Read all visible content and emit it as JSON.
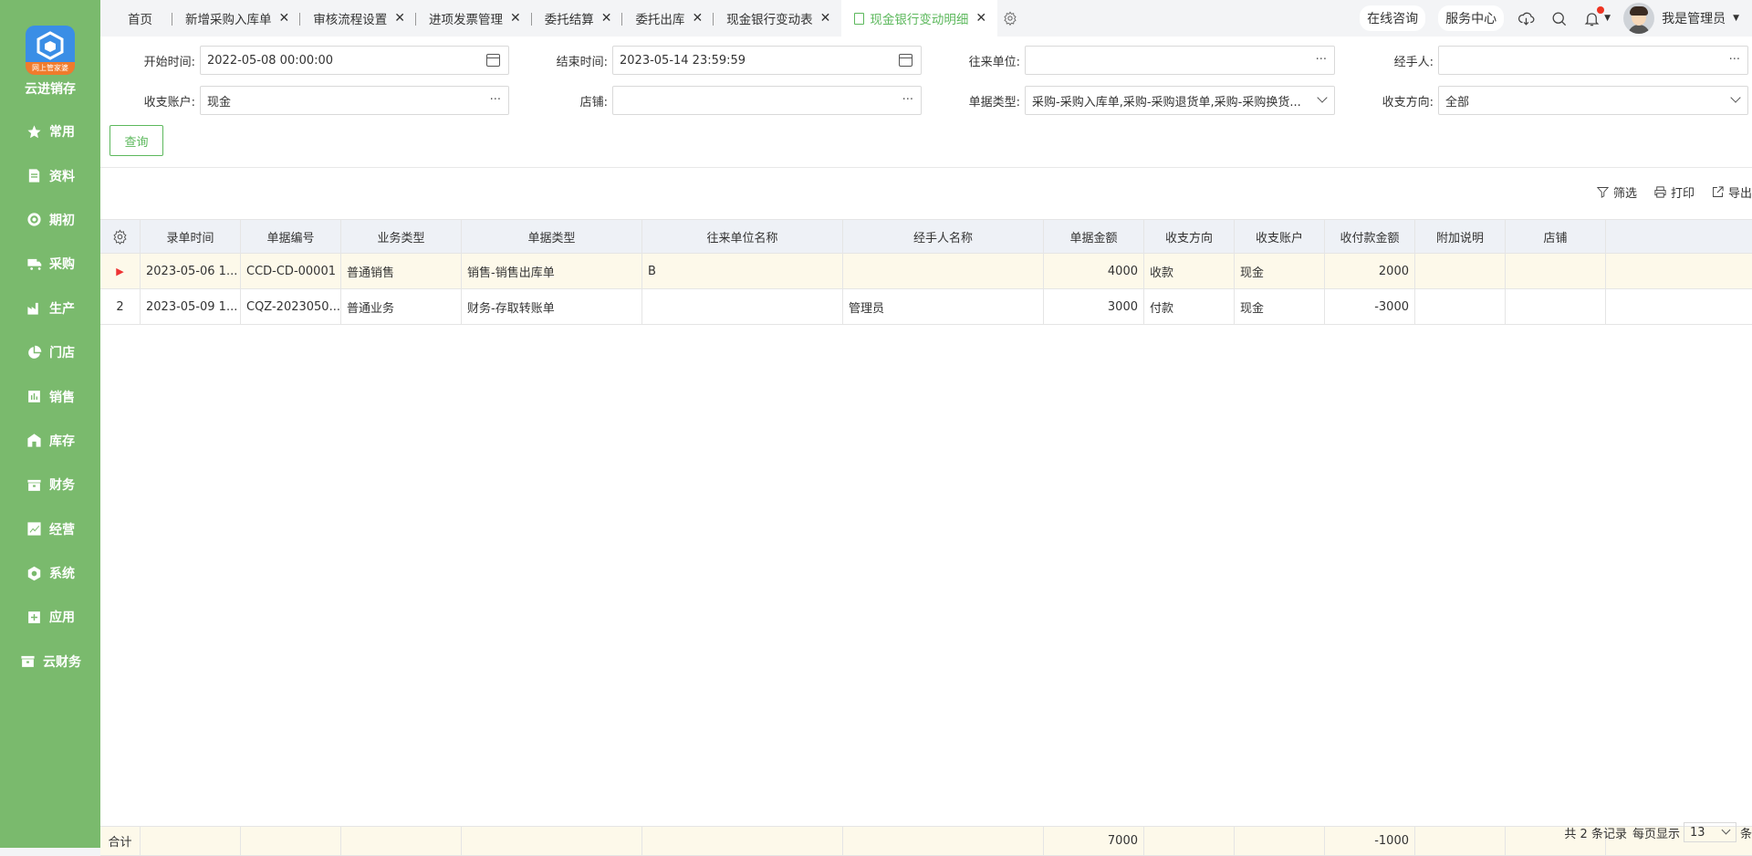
{
  "app": {
    "brand": "云进销存",
    "logo_ribbon": "网上管家婆"
  },
  "sidebar": {
    "items": [
      {
        "label": "常用",
        "icon": "star-icon"
      },
      {
        "label": "资料",
        "icon": "document-icon"
      },
      {
        "label": "期初",
        "icon": "target-icon"
      },
      {
        "label": "采购",
        "icon": "truck-icon"
      },
      {
        "label": "生产",
        "icon": "factory-icon"
      },
      {
        "label": "门店",
        "icon": "pie-chart-icon"
      },
      {
        "label": "销售",
        "icon": "bar-chart-icon"
      },
      {
        "label": "库存",
        "icon": "warehouse-icon"
      },
      {
        "label": "财务",
        "icon": "wallet-icon"
      },
      {
        "label": "经营",
        "icon": "trend-icon"
      },
      {
        "label": "系统",
        "icon": "settings-icon"
      },
      {
        "label": "应用",
        "icon": "plus-icon"
      },
      {
        "label": "云财务",
        "icon": "cloud-finance-icon"
      }
    ]
  },
  "tabs": {
    "items": [
      {
        "label": "首页"
      },
      {
        "label": "新增采购入库单"
      },
      {
        "label": "审核流程设置"
      },
      {
        "label": "进项发票管理"
      },
      {
        "label": "委托结算"
      },
      {
        "label": "委托出库"
      },
      {
        "label": "现金银行变动表"
      },
      {
        "label": "现金银行变动明细"
      }
    ]
  },
  "header": {
    "online_consult": "在线咨询",
    "service_center": "服务中心",
    "user_name": "我是管理员"
  },
  "filters": {
    "start_time_label": "开始时间:",
    "start_time_value": "2022-05-08 00:00:00",
    "end_time_label": "结束时间:",
    "end_time_value": "2023-05-14 23:59:59",
    "partner_label": "往来单位:",
    "partner_value": "",
    "handler_label": "经手人:",
    "handler_value": "",
    "account_label": "收支账户:",
    "account_value": "现金",
    "store_label": "店铺:",
    "store_value": "",
    "doc_type_label": "单据类型:",
    "doc_type_value": "采购-采购入库单,采购-采购退货单,采购-采购换货...",
    "direction_label": "收支方向:",
    "direction_value": "全部",
    "query_button": "查询"
  },
  "toolbar": {
    "filter": "筛选",
    "print": "打印",
    "export": "导出"
  },
  "table": {
    "columns": [
      "录单时间",
      "单据编号",
      "业务类型",
      "单据类型",
      "往来单位名称",
      "经手人名称",
      "单据金额",
      "收支方向",
      "收支账户",
      "收付款金额",
      "附加说明",
      "店铺"
    ],
    "rows": [
      {
        "idx": "▶",
        "time": "2023-05-06 1...",
        "code": "CCD-CD-00001",
        "biz": "普通销售",
        "doctype": "销售-销售出库单",
        "partner": "B",
        "handler": "",
        "amount": "4000",
        "dir": "收款",
        "account": "现金",
        "pay": "2000",
        "note": "",
        "store": ""
      },
      {
        "idx": "2",
        "time": "2023-05-09 1...",
        "code": "CQZ-2023050...",
        "biz": "普通业务",
        "doctype": "财务-存取转账单",
        "partner": "",
        "handler": "管理员",
        "amount": "3000",
        "dir": "付款",
        "account": "现金",
        "pay": "-3000",
        "note": "",
        "store": ""
      }
    ],
    "footer": {
      "label": "合计",
      "amount": "7000",
      "pay": "-1000"
    }
  },
  "pager": {
    "total": "共 2 条记录",
    "per_page_label": "每页显示",
    "per_page": "13",
    "unit": "条"
  },
  "colors": {
    "sidebar": "#7aba6d",
    "accent": "#5cb85c",
    "row_highlight": "#fdf9ea",
    "header_bg": "#eef1f6"
  }
}
